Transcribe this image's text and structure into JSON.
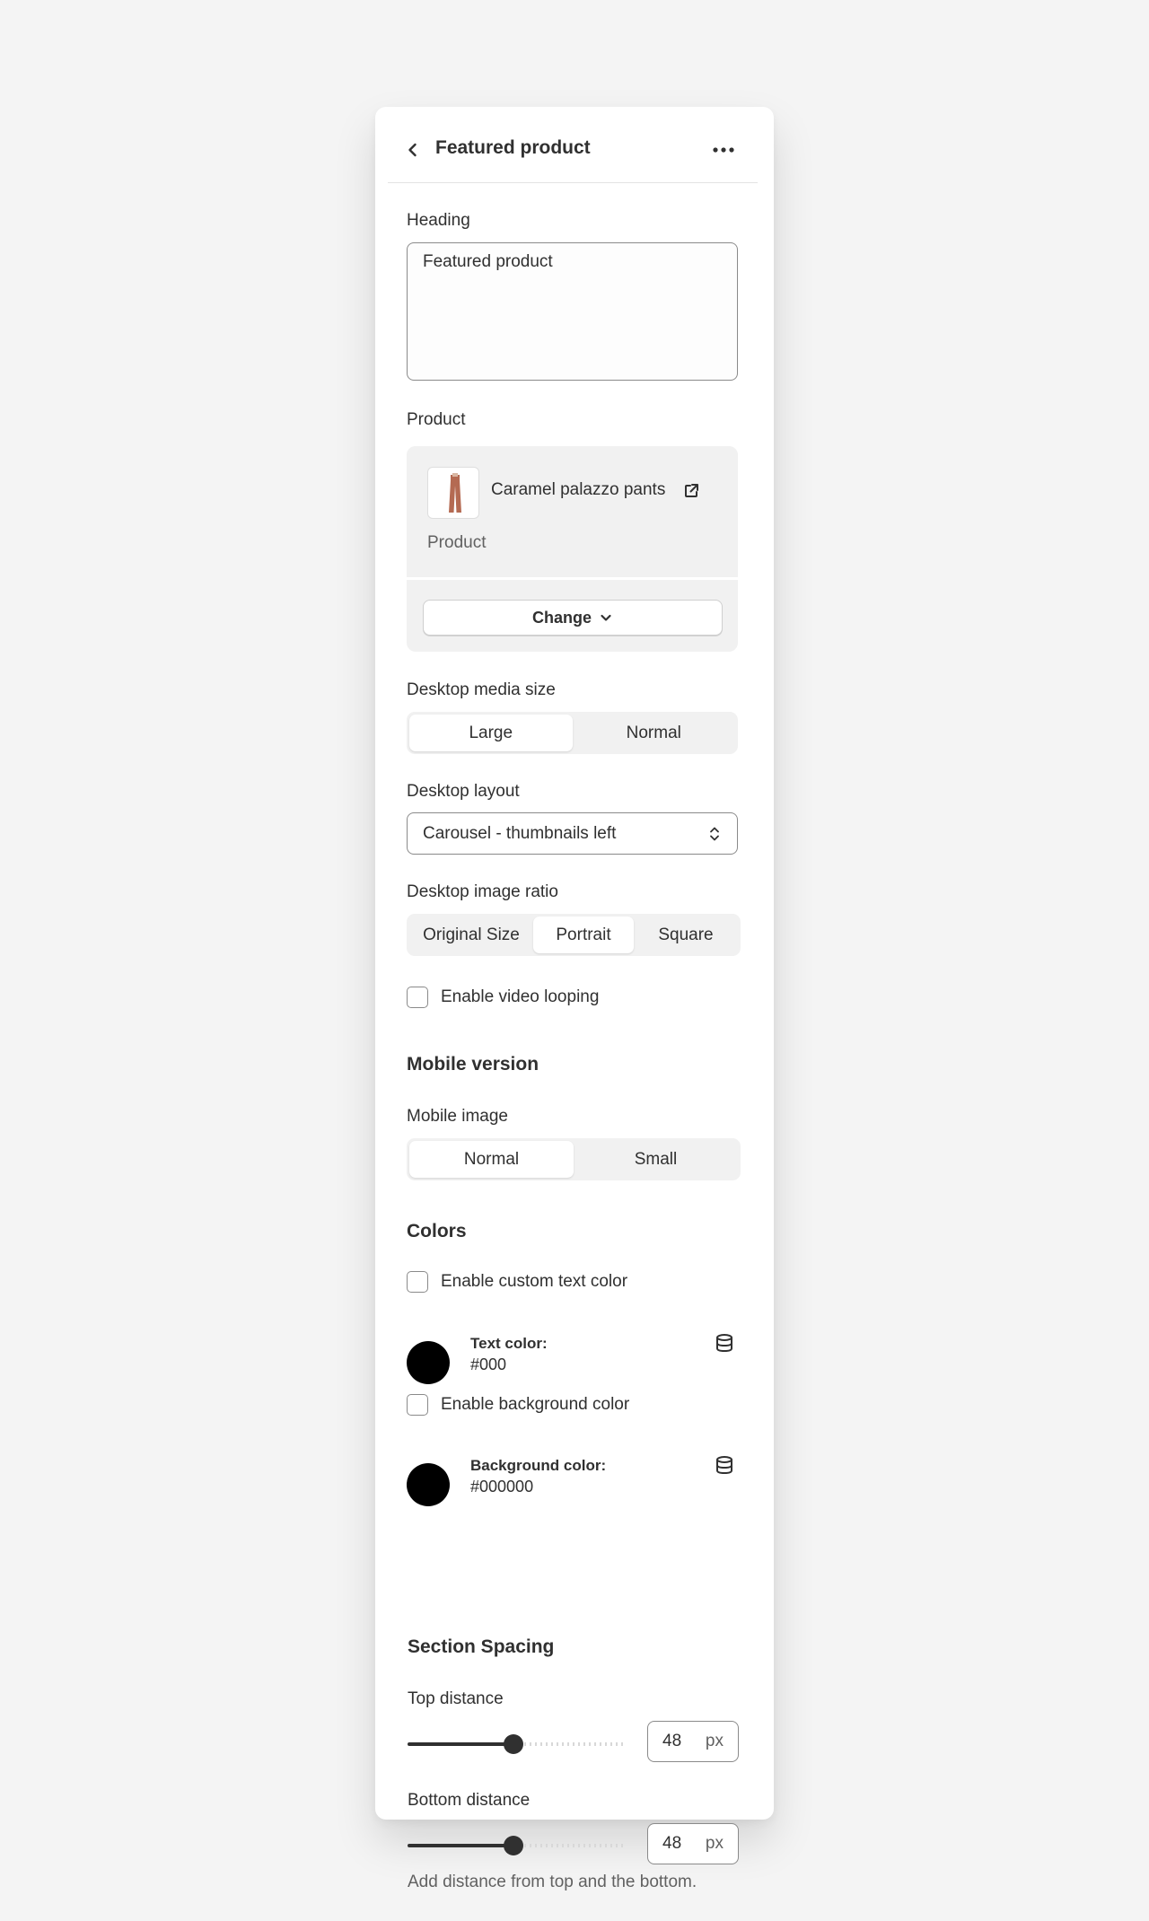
{
  "header": {
    "title": "Featured product",
    "back_icon": "chevron-left-icon",
    "menu_icon": "more-horizontal-icon"
  },
  "heading": {
    "label": "Heading",
    "value": "Featured product"
  },
  "product": {
    "label": "Product",
    "name": "Caramel palazzo pants",
    "type_label": "Product",
    "external_icon": "external-link-icon",
    "change_label": "Change",
    "change_icon": "chevron-down-icon"
  },
  "desktop_media_size": {
    "label": "Desktop media size",
    "options": [
      "Large",
      "Normal"
    ],
    "selected": "Large"
  },
  "desktop_layout": {
    "label": "Desktop layout",
    "value": "Carousel - thumbnails left",
    "icon": "select-arrows-icon"
  },
  "desktop_image_ratio": {
    "label": "Desktop image ratio",
    "options": [
      "Original Size",
      "Portrait",
      "Square"
    ],
    "selected": "Portrait"
  },
  "video_looping": {
    "label": "Enable video looping",
    "checked": false
  },
  "mobile": {
    "title": "Mobile version",
    "image_label": "Mobile image",
    "options": [
      "Normal",
      "Small"
    ],
    "selected": "Normal"
  },
  "colors": {
    "title": "Colors",
    "custom_text_color": {
      "label": "Enable custom text color",
      "checked": false
    },
    "text_color": {
      "label": "Text color:",
      "value": "#000",
      "swatch": "#000000",
      "icon": "database-icon"
    },
    "background_toggle": {
      "label": "Enable background color",
      "checked": false
    },
    "background_color": {
      "label": "Background color:",
      "value": "#000000",
      "swatch": "#000000",
      "icon": "database-icon"
    }
  },
  "spacing": {
    "title": "Section Spacing",
    "top": {
      "label": "Top distance",
      "value": "48",
      "unit": "px",
      "level": 0.48
    },
    "bottom": {
      "label": "Bottom distance",
      "value": "48",
      "unit": "px",
      "level": 0.48
    },
    "help": "Add distance from top and the bottom."
  }
}
